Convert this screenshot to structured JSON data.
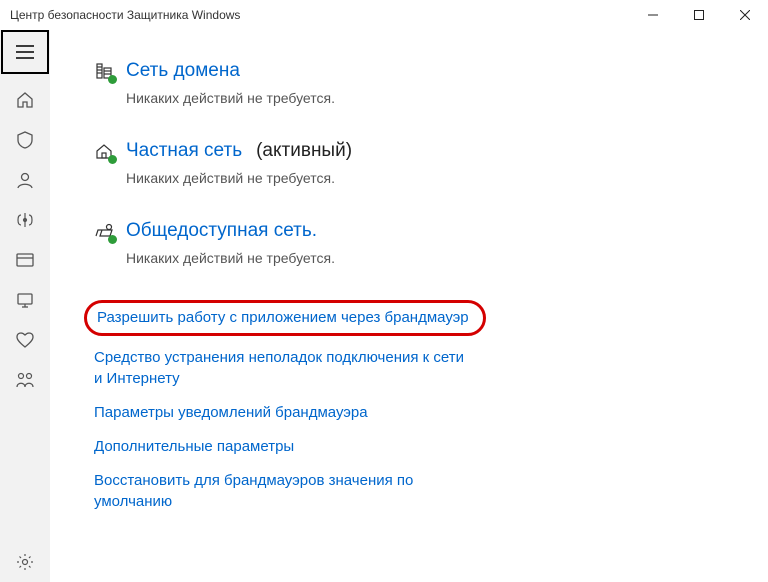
{
  "window": {
    "title": "Центр безопасности Защитника Windows"
  },
  "sections": {
    "domain": {
      "title": "Сеть домена",
      "status": "Никаких действий не требуется."
    },
    "private": {
      "title": "Частная сеть",
      "suffix": "(активный)",
      "status": "Никаких действий не требуется."
    },
    "public": {
      "title": "Общедоступная сеть.",
      "status": "Никаких действий не требуется."
    }
  },
  "links": {
    "allow_app": "Разрешить работу с приложением через брандмауэр",
    "troubleshoot": "Средство устранения неполадок подключения к сети и Интернету",
    "notifications": "Параметры уведомлений брандмауэра",
    "advanced": "Дополнительные параметры",
    "restore": "Восстановить для брандмауэров значения по умолчанию"
  }
}
